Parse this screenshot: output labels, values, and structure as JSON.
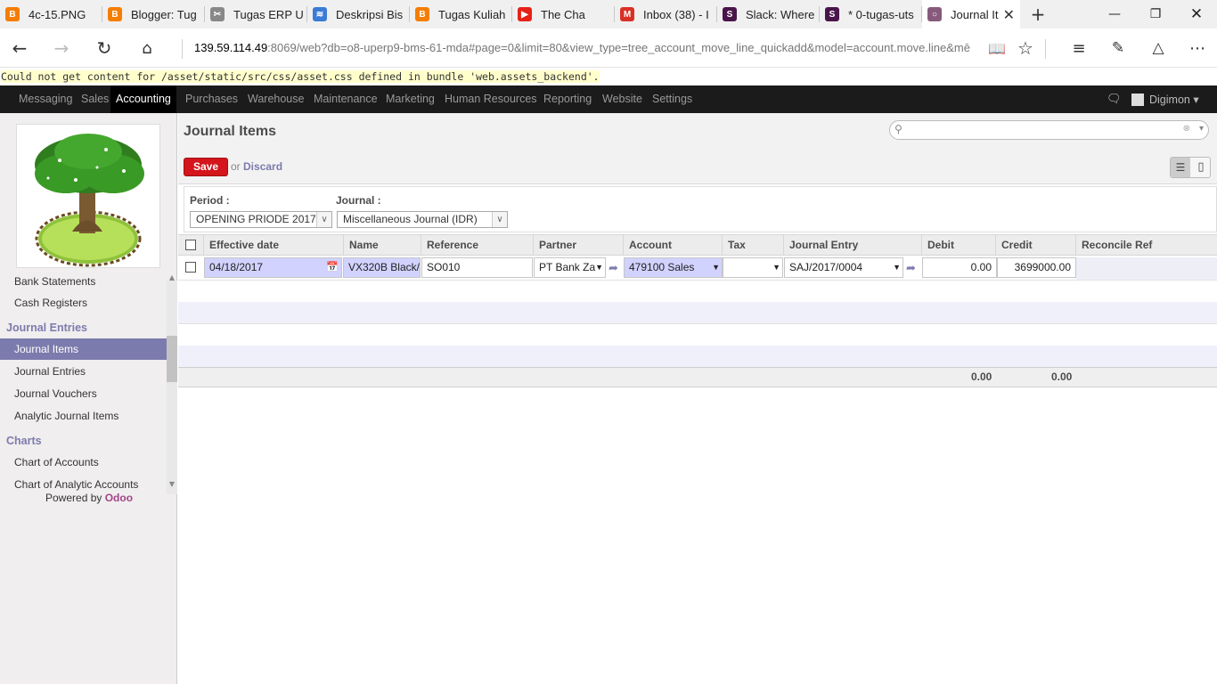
{
  "browser": {
    "tabs": [
      {
        "label": "4c-15.PNG",
        "icon": "blogger-icon",
        "color": "#f57d00"
      },
      {
        "label": "Blogger: Tug",
        "icon": "blogger-icon",
        "color": "#f57d00"
      },
      {
        "label": "Tugas ERP U",
        "icon": "scissors-icon",
        "color": "#888888"
      },
      {
        "label": "Deskripsi Bis",
        "icon": "stack-icon",
        "color": "#3a7bd5"
      },
      {
        "label": "Tugas Kuliah",
        "icon": "blogger-icon",
        "color": "#f57d00"
      },
      {
        "label": "The Cha",
        "icon": "youtube-icon",
        "color": "#e62117"
      },
      {
        "label": "Inbox (38) - I",
        "icon": "gmail-icon",
        "color": "#d93025"
      },
      {
        "label": "Slack: Where",
        "icon": "slack-icon",
        "color": "#4a154b"
      },
      {
        "label": "* 0-tugas-uts",
        "icon": "slack-icon",
        "color": "#4a154b"
      },
      {
        "label": "Journal It",
        "icon": "odoo-icon",
        "color": "#875a7b"
      }
    ],
    "url_host": "139.59.114.49",
    "url_rest": ":8069/web?db=o8-uperp9-bms-61-mda#page=0&limit=80&view_type=tree_account_move_line_quickadd&model=account.move.line&mē"
  },
  "warning": "Could not get content for /asset/static/src/css/asset.css defined in bundle 'web.assets_backend'.",
  "menu": {
    "items": [
      "Messaging",
      "Sales",
      "Accounting",
      "Purchases",
      "Warehouse",
      "Maintenance",
      "Marketing",
      "Human Resources",
      "Reporting",
      "Website",
      "Settings"
    ],
    "active": "Accounting",
    "user": "Digimon"
  },
  "sidebar": {
    "items": [
      {
        "label": "Bank Statements",
        "type": "item"
      },
      {
        "label": "Cash Registers",
        "type": "item"
      },
      {
        "label": "Journal Entries",
        "type": "head"
      },
      {
        "label": "Journal Items",
        "type": "active"
      },
      {
        "label": "Journal Entries",
        "type": "item"
      },
      {
        "label": "Journal Vouchers",
        "type": "item"
      },
      {
        "label": "Analytic Journal Items",
        "type": "item"
      },
      {
        "label": "Charts",
        "type": "head"
      },
      {
        "label": "Chart of Accounts",
        "type": "item"
      },
      {
        "label": "Chart of Analytic Accounts",
        "type": "item"
      }
    ],
    "powered_by": "Powered by",
    "powered_brand": "Odoo"
  },
  "view": {
    "title": "Journal Items",
    "save_label": "Save",
    "or_label": "or",
    "discard_label": "Discard",
    "search_placeholder": ""
  },
  "filters": {
    "period_label": "Period :",
    "period_value": "OPENING PRIODE 2017",
    "journal_label": "Journal :",
    "journal_value": "Miscellaneous Journal (IDR)"
  },
  "grid": {
    "columns": [
      "Effective date",
      "Name",
      "Reference",
      "Partner",
      "Account",
      "Tax",
      "Journal Entry",
      "Debit",
      "Credit",
      "Reconcile Ref"
    ],
    "row": {
      "effective_date": "04/18/2017",
      "name": "/VX320B Black",
      "reference": "SO010",
      "partner": "PT Bank Za",
      "account": "479100 Sales",
      "tax": "",
      "journal_entry": "SAJ/2017/0004",
      "debit": "0.00",
      "credit": "3699000.00"
    },
    "total_debit": "0.00",
    "total_credit": "0.00"
  }
}
